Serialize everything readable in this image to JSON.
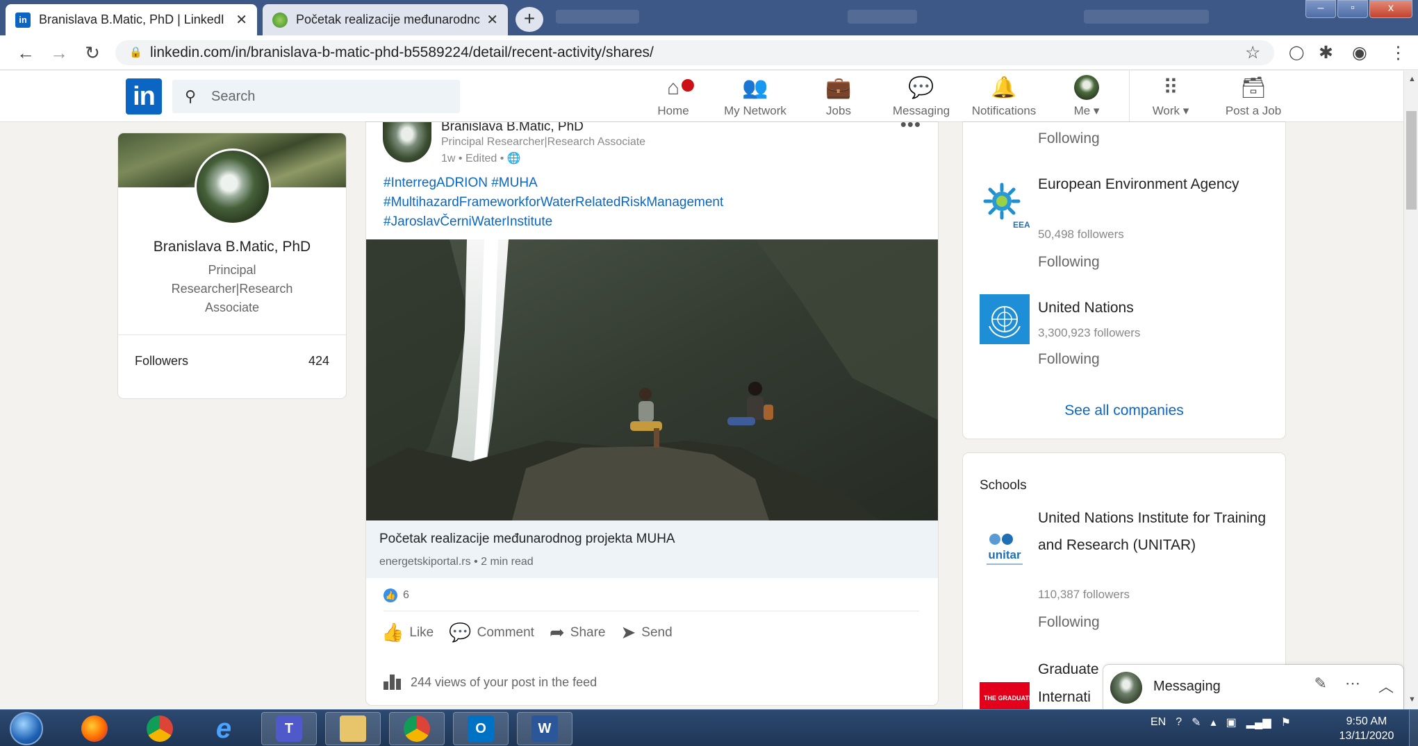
{
  "browser": {
    "tabs": [
      {
        "title": "Branislava B.Matic, PhD | LinkedI",
        "favicon": "in",
        "active": true
      },
      {
        "title": "Početak realizacije međunarodnc",
        "favicon": "",
        "active": false
      }
    ],
    "new_tab": "+",
    "url": "linkedin.com/in/branislava-b-matic-phd-b5589224/detail/recent-activity/shares/",
    "window_buttons": {
      "minimize": "–",
      "maximize": "▫",
      "close": "x"
    }
  },
  "linkedin": {
    "logo": "in",
    "search_placeholder": "Search",
    "nav": [
      {
        "label": "Home",
        "icon": "home-icon"
      },
      {
        "label": "My Network",
        "icon": "network-icon"
      },
      {
        "label": "Jobs",
        "icon": "jobs-icon"
      },
      {
        "label": "Messaging",
        "icon": "messaging-icon"
      },
      {
        "label": "Notifications",
        "icon": "bell-icon"
      },
      {
        "label": "Me ▾",
        "icon": "avatar"
      },
      {
        "label": "Work ▾",
        "icon": "grid-icon"
      },
      {
        "label": "Post a Job",
        "icon": "post-job-icon"
      }
    ]
  },
  "profile": {
    "name": "Branislava B.Matic, PhD",
    "headline": "Principal Researcher|Research Associate",
    "followers_label": "Followers",
    "followers_count": "424"
  },
  "post": {
    "author": "Branislava B.Matic, PhD",
    "headline": "Principal Researcher|Research Associate",
    "meta": "1w • Edited •",
    "more": "•••",
    "hashtags": [
      "#InterregADRION #MUHA",
      "#MultihazardFrameworkforWaterRelatedRiskManagement",
      "#JaroslavČerniWaterInstitute"
    ],
    "article_title": "Početak realizacije međunarodnog projekta MUHA",
    "article_meta": "energetskiportal.rs • 2 min read",
    "reaction_count": "6",
    "actions": [
      "Like",
      "Comment",
      "Share",
      "Send"
    ],
    "views": "244 views of your post in the feed"
  },
  "companies": {
    "top_following": "Following",
    "items": [
      {
        "name": "European Environment Agency",
        "followers": "50,498 followers",
        "status": "Following",
        "logo_text": "EEA"
      },
      {
        "name": "United Nations",
        "followers": "3,300,923 followers",
        "status": "Following"
      }
    ],
    "see_all": "See all companies"
  },
  "schools": {
    "title": "Schools",
    "items": [
      {
        "name": "United Nations Institute for Training and Research (UNITAR)",
        "followers": "110,387 followers",
        "status": "Following",
        "logo_text": "unitar"
      },
      {
        "name": "Graduate",
        "name2": "Internati",
        "logo_text": "THE GRADUATE INSTITUTE"
      }
    ]
  },
  "messaging": {
    "label": "Messaging"
  },
  "taskbar": {
    "tray_lang": "EN",
    "time": "9:50 AM",
    "date": "13/11/2020"
  },
  "colors": {
    "linkedin_blue": "#0a66c2",
    "chrome_titlebar": "#3d5787",
    "page_bg": "#f3f2ef"
  }
}
